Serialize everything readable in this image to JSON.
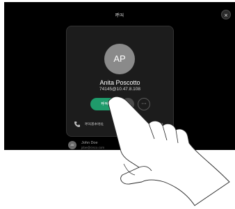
{
  "header": {
    "title": "呼叫",
    "close_symbol": "×"
  },
  "contact": {
    "initials": "AP",
    "name": "Anita Poscotto",
    "number": "74145@10.47.8.108"
  },
  "actions": {
    "call_label": "呼叫",
    "favorite_symbol": "★",
    "more_symbol": "···"
  },
  "details": {
    "row_label": "呼叫基本地址",
    "chevron": "›"
  },
  "recent": {
    "initials": "JD",
    "name": "John Doe",
    "email": "jdoe@cisco.com"
  },
  "colors": {
    "call_accent": "#1f9b6b",
    "screen_background": "#000000",
    "card_background": "#1c1c1c"
  }
}
